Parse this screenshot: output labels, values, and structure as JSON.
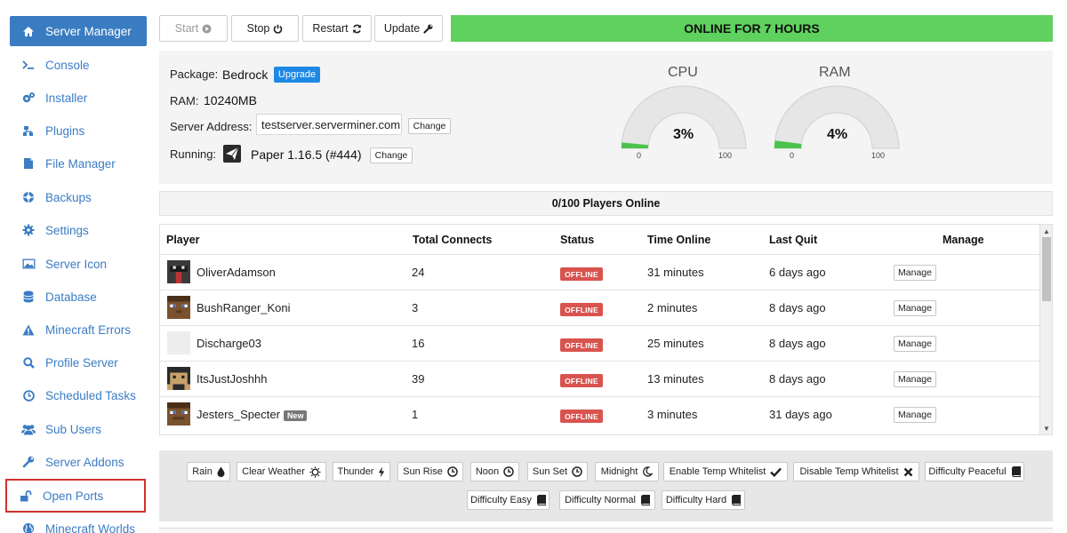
{
  "sidebar": {
    "items": [
      {
        "label": "Server Manager",
        "icon": "home-icon"
      },
      {
        "label": "Console",
        "icon": "terminal-icon"
      },
      {
        "label": "Installer",
        "icon": "cogs-icon"
      },
      {
        "label": "Plugins",
        "icon": "sitemap-icon"
      },
      {
        "label": "File Manager",
        "icon": "file-icon"
      },
      {
        "label": "Backups",
        "icon": "lifebuoy-icon"
      },
      {
        "label": "Settings",
        "icon": "gear-icon"
      },
      {
        "label": "Server Icon",
        "icon": "image-icon"
      },
      {
        "label": "Database",
        "icon": "database-icon"
      },
      {
        "label": "Minecraft Errors",
        "icon": "warning-icon"
      },
      {
        "label": "Profile Server",
        "icon": "search-icon"
      },
      {
        "label": "Scheduled Tasks",
        "icon": "clock-icon"
      },
      {
        "label": "Sub Users",
        "icon": "users-icon"
      },
      {
        "label": "Server Addons",
        "icon": "wrench-icon"
      },
      {
        "label": "Open Ports",
        "icon": "unlock-icon"
      },
      {
        "label": "Minecraft Worlds",
        "icon": "globe-icon"
      }
    ]
  },
  "toolbar": {
    "start_label": "Start",
    "stop_label": "Stop",
    "restart_label": "Restart",
    "update_label": "Update",
    "status_banner": "ONLINE FOR 7 HOURS"
  },
  "server": {
    "package_label": "Package:",
    "package_value": "Bedrock",
    "upgrade_label": "Upgrade",
    "ram_label": "RAM:",
    "ram_value": "10240MB",
    "address_label": "Server Address:",
    "address_value": "testserver.serverminer.com",
    "change_label": "Change",
    "running_label": "Running:",
    "running_value": "Paper 1.16.5 (#444)"
  },
  "gauges": {
    "cpu": {
      "title": "CPU",
      "value_text": "3%",
      "value": 3,
      "min": "0",
      "max": "100"
    },
    "ram": {
      "title": "RAM",
      "value_text": "4%",
      "value": 4,
      "min": "0",
      "max": "100"
    }
  },
  "players": {
    "header": "0/100 Players Online",
    "columns": [
      "Player",
      "Total Connects",
      "Status",
      "Time Online",
      "Last Quit",
      "Manage"
    ],
    "new_badge": "New",
    "manage_label": "Manage",
    "rows": [
      {
        "name": "OliverAdamson",
        "connects": "24",
        "status": "OFFLINE",
        "time_online": "31 minutes",
        "last_quit": "6 days ago"
      },
      {
        "name": "BushRanger_Koni",
        "connects": "3",
        "status": "OFFLINE",
        "time_online": "2 minutes",
        "last_quit": "8 days ago"
      },
      {
        "name": "Discharge03",
        "connects": "16",
        "status": "OFFLINE",
        "time_online": "25 minutes",
        "last_quit": "8 days ago"
      },
      {
        "name": "ItsJustJoshhh",
        "connects": "39",
        "status": "OFFLINE",
        "time_online": "13 minutes",
        "last_quit": "8 days ago"
      },
      {
        "name": "Jesters_Specter",
        "connects": "1",
        "status": "OFFLINE",
        "time_online": "3 minutes",
        "last_quit": "31 days ago"
      }
    ]
  },
  "actions": {
    "rain": "Rain",
    "clear_weather": "Clear Weather",
    "thunder": "Thunder",
    "sun_rise": "Sun Rise",
    "noon": "Noon",
    "sun_set": "Sun Set",
    "midnight": "Midnight",
    "enable_temp_whitelist": "Enable Temp Whitelist",
    "disable_temp_whitelist": "Disable Temp Whitelist",
    "difficulty_peaceful": "Difficulty Peaceful",
    "difficulty_easy": "Difficulty Easy",
    "difficulty_normal": "Difficulty Normal",
    "difficulty_hard": "Difficulty Hard"
  },
  "colors": {
    "accent": "#3a7cc1",
    "online": "#5fd15f",
    "offline": "#d9534f",
    "highlight": "#d0302c",
    "gauge_fill": "#4cc34c"
  }
}
